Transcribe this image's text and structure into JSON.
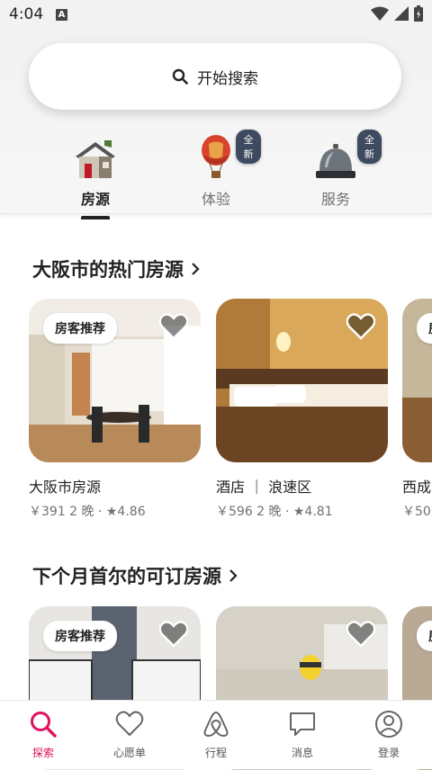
{
  "status_bar": {
    "time": "4:04",
    "notification_letter": "A"
  },
  "search": {
    "placeholder": "开始搜索"
  },
  "categories": [
    {
      "label": "房源",
      "active": true,
      "badge": ""
    },
    {
      "label": "体验",
      "active": false,
      "badge": "全新"
    },
    {
      "label": "服务",
      "active": false,
      "badge": "全新"
    }
  ],
  "sections": [
    {
      "title": "大阪市的热门房源",
      "cards": [
        {
          "badge": "房客推荐",
          "title": "大阪市房源",
          "meta": "￥391 2 晚 · ★4.86"
        },
        {
          "badge": "",
          "title": "酒店 ｜ 浪速区",
          "meta": "￥596 2 晚 · ★4.81"
        },
        {
          "badge": "房",
          "title": "西成",
          "meta": "￥50"
        }
      ]
    },
    {
      "title": "下个月首尔的可订房源",
      "cards": [
        {
          "badge": "房客推荐"
        },
        {
          "badge": ""
        },
        {
          "badge": "房"
        }
      ]
    }
  ],
  "bottom_nav": [
    {
      "label": "探索",
      "icon": "search-icon",
      "active": true
    },
    {
      "label": "心愿单",
      "icon": "heart-icon",
      "active": false
    },
    {
      "label": "行程",
      "icon": "airbnb-logo-icon",
      "active": false
    },
    {
      "label": "消息",
      "icon": "message-icon",
      "active": false
    },
    {
      "label": "登录",
      "icon": "profile-icon",
      "active": false
    }
  ],
  "colors": {
    "accent": "#e0115f",
    "badge_bg": "#3d4a5f"
  }
}
